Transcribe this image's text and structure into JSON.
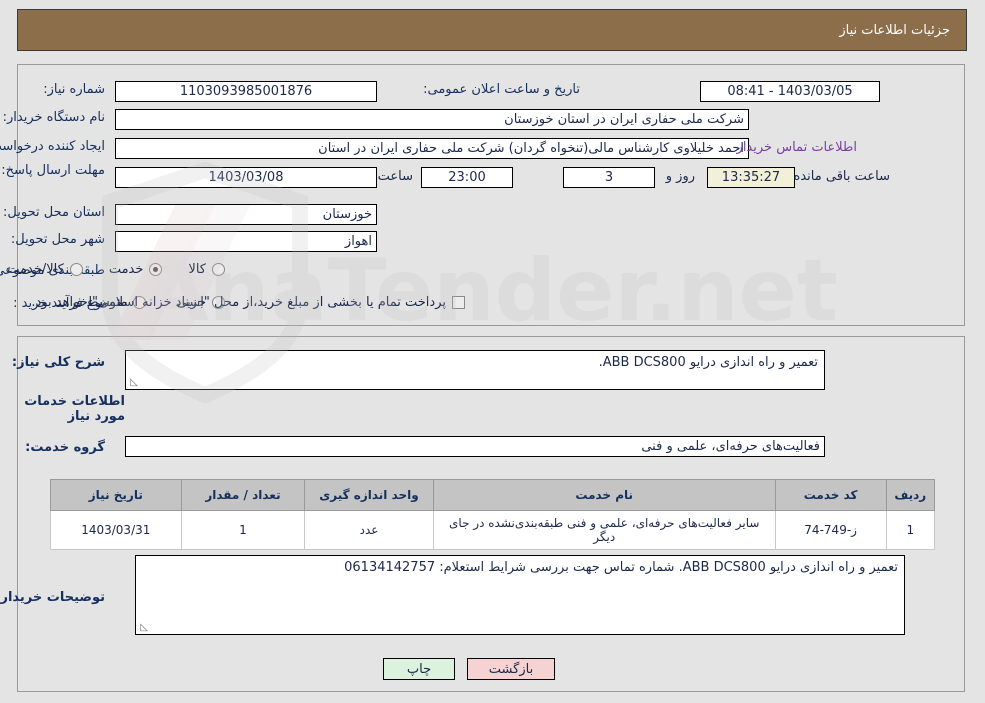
{
  "header": {
    "title": "جزئیات اطلاعات نیاز"
  },
  "watermark": {
    "text": "AnaTender.net"
  },
  "form": {
    "need_number_label": "شماره نیاز:",
    "need_number_value": "1103093985001876",
    "announce_label": "تاریخ و ساعت اعلان عمومی:",
    "announce_value": "1403/03/05 - 08:41",
    "buyer_org_label": "نام دستگاه خریدار:",
    "buyer_org_value": "شرکت ملی حفاری ایران در استان خوزستان",
    "creator_label": "ایجاد کننده درخواست:",
    "creator_value": "احمد خلیلاوی کارشناس مالی(تنخواه گردان) شرکت ملی حفاری ایران در استان",
    "contact_link": "اطلاعات تماس خریدار",
    "deadline_label": "مهلت ارسال پاسخ: تا تاریخ:",
    "deadline_date": "1403/03/08",
    "deadline_hour_label": "ساعت",
    "deadline_hour": "23:00",
    "days_value": "3",
    "days_label": "روز و",
    "countdown": "13:35:27",
    "countdown_label": "ساعت باقی مانده",
    "province_label": "استان محل تحویل:",
    "province_value": "خوزستان",
    "city_label": "شهر محل تحویل:",
    "city_value": "اهواز",
    "category_label": "طبقه بندی موضوعی:",
    "category_options": [
      {
        "label": "کالا",
        "selected": false
      },
      {
        "label": "خدمت",
        "selected": true
      },
      {
        "label": "کالا/خدمت",
        "selected": false
      }
    ],
    "process_label": "نوع فرآیند خرید :",
    "process_options": [
      {
        "label": "جزیی",
        "selected": false
      },
      {
        "label": "متوسط",
        "selected": false
      }
    ],
    "treasury_checkbox_label": "پرداخت تمام یا بخشی از مبلغ خرید،از محل \"اسناد خزانه اسلامی\" خواهد بود.",
    "treasury_checked": false
  },
  "details": {
    "summary_label": "شرح کلی نیاز:",
    "summary_value": "تعمیر و راه اندازی درایو ABB DCS800.",
    "services_heading": "اطلاعات خدمات مورد نیاز",
    "service_group_label": "گروه خدمت:",
    "service_group_value": "فعالیت‌های حرفه‌ای، علمی و فنی",
    "buyer_notes_label": "توضیحات خریدار:",
    "buyer_notes_value": "تعمیر و راه اندازی درایو ABB DCS800. شماره تماس جهت بررسی شرایط استعلام: 06134142757"
  },
  "table": {
    "columns": [
      "ردیف",
      "کد خدمت",
      "نام خدمت",
      "واحد اندازه گیری",
      "تعداد / مقدار",
      "تاریخ نیاز"
    ],
    "rows": [
      {
        "radif": "1",
        "code": "ز-749-74",
        "name": "سایر فعالیت‌های حرفه‌ای، علمی و فنی طبقه‌بندی‌نشده در جای دیگر",
        "unit": "عدد",
        "qty": "1",
        "date": "1403/03/31"
      }
    ]
  },
  "buttons": {
    "back": "بازگشت",
    "print": "چاپ"
  }
}
